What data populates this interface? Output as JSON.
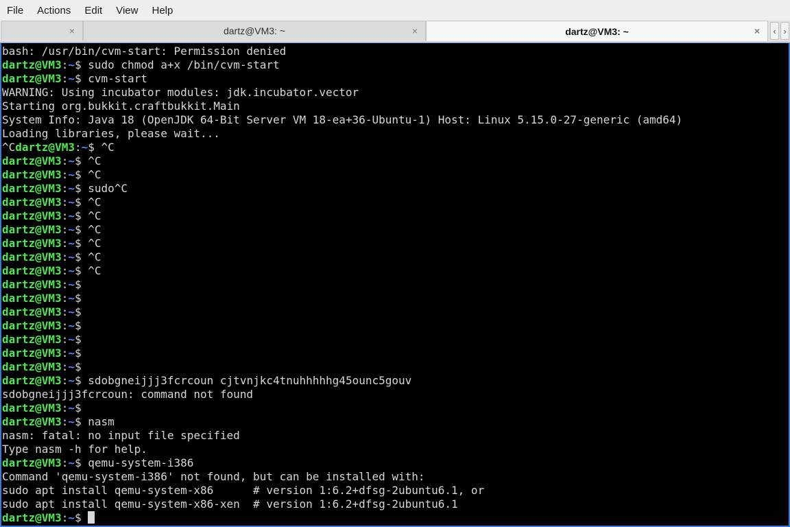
{
  "menubar": {
    "items": [
      "File",
      "Actions",
      "Edit",
      "View",
      "Help"
    ]
  },
  "tabs": [
    {
      "label": "",
      "active": false
    },
    {
      "label": "dartz@VM3: ~",
      "active": false
    },
    {
      "label": "dartz@VM3: ~",
      "active": true
    }
  ],
  "tab_close_glyph": "×",
  "tab_nav": {
    "prev": "‹",
    "next": "›"
  },
  "terminal": {
    "colors": {
      "background": "#000000",
      "user": "#4ee84e",
      "path": "#5c84ff",
      "text": "#d6d6d6"
    },
    "prompt": {
      "user_host": "dartz@VM3",
      "sep": ":",
      "path": "~",
      "symbol": "$"
    },
    "lines": [
      {
        "type": "output",
        "text": "bash: /usr/bin/cvm-start: Permission denied"
      },
      {
        "type": "prompt",
        "cmd": " sudo chmod a+x /bin/cvm-start"
      },
      {
        "type": "prompt",
        "cmd": " cvm-start"
      },
      {
        "type": "output",
        "text": "WARNING: Using incubator modules: jdk.incubator.vector"
      },
      {
        "type": "output",
        "text": "Starting org.bukkit.craftbukkit.Main"
      },
      {
        "type": "output",
        "text": "System Info: Java 18 (OpenJDK 64-Bit Server VM 18-ea+36-Ubuntu-1) Host: Linux 5.15.0-27-generic (amd64)"
      },
      {
        "type": "output",
        "text": "Loading libraries, please wait..."
      },
      {
        "type": "prompt",
        "pre": "^C",
        "cmd": " ^C"
      },
      {
        "type": "prompt",
        "cmd": " ^C"
      },
      {
        "type": "prompt",
        "cmd": " ^C"
      },
      {
        "type": "prompt",
        "cmd": " sudo^C"
      },
      {
        "type": "prompt",
        "cmd": " ^C"
      },
      {
        "type": "prompt",
        "cmd": " ^C"
      },
      {
        "type": "prompt",
        "cmd": " ^C"
      },
      {
        "type": "prompt",
        "cmd": " ^C"
      },
      {
        "type": "prompt",
        "cmd": " ^C"
      },
      {
        "type": "prompt",
        "cmd": " ^C"
      },
      {
        "type": "prompt",
        "cmd": ""
      },
      {
        "type": "prompt",
        "cmd": ""
      },
      {
        "type": "prompt",
        "cmd": ""
      },
      {
        "type": "prompt",
        "cmd": ""
      },
      {
        "type": "prompt",
        "cmd": ""
      },
      {
        "type": "prompt",
        "cmd": ""
      },
      {
        "type": "prompt",
        "cmd": ""
      },
      {
        "type": "prompt",
        "cmd": " sdobgneijjj3fcrcoun cjtvnjkc4tnuhhhhhg45ounc5gouv"
      },
      {
        "type": "output",
        "text": "sdobgneijjj3fcrcoun: command not found"
      },
      {
        "type": "prompt",
        "cmd": ""
      },
      {
        "type": "prompt",
        "cmd": " nasm"
      },
      {
        "type": "output",
        "text": "nasm: fatal: no input file specified"
      },
      {
        "type": "output",
        "text": "Type nasm -h for help."
      },
      {
        "type": "prompt",
        "cmd": " qemu-system-i386"
      },
      {
        "type": "output",
        "text": "Command 'qemu-system-i386' not found, but can be installed with:"
      },
      {
        "type": "output",
        "text": "sudo apt install qemu-system-x86      # version 1:6.2+dfsg-2ubuntu6.1, or"
      },
      {
        "type": "output",
        "text": "sudo apt install qemu-system-x86-xen  # version 1:6.2+dfsg-2ubuntu6.1"
      },
      {
        "type": "prompt",
        "cmd": " ",
        "cursor": true
      }
    ]
  }
}
